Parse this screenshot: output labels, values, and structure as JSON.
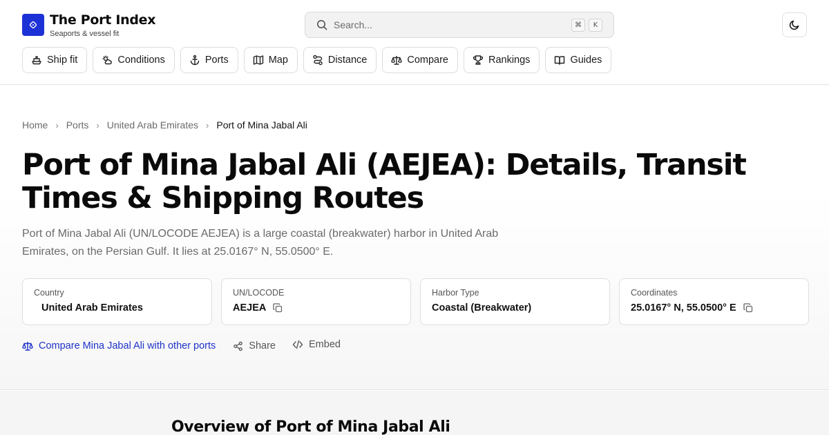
{
  "brand": {
    "title": "The Port Index",
    "subtitle": "Seaports & vessel fit",
    "accent_color": "#1d32d6",
    "logo_icon": "compass-diamond-icon"
  },
  "search": {
    "placeholder": "Search...",
    "shortcut_keys": [
      "⌘",
      "K"
    ]
  },
  "theme_toggle": {
    "icon": "moon-icon"
  },
  "nav": [
    {
      "label": "Ship fit",
      "icon": "ship-icon"
    },
    {
      "label": "Conditions",
      "icon": "weather-icon"
    },
    {
      "label": "Ports",
      "icon": "anchor-icon"
    },
    {
      "label": "Map",
      "icon": "map-icon"
    },
    {
      "label": "Distance",
      "icon": "route-icon"
    },
    {
      "label": "Compare",
      "icon": "scale-icon"
    },
    {
      "label": "Rankings",
      "icon": "trophy-icon"
    },
    {
      "label": "Guides",
      "icon": "book-icon"
    }
  ],
  "breadcrumb": [
    "Home",
    "Ports",
    "United Arab Emirates",
    "Port of Mina Jabal Ali"
  ],
  "page": {
    "title": "Port of Mina Jabal Ali (AEJEA): Details, Transit Times & Shipping Routes",
    "lead": "Port of Mina Jabal Ali (UN/LOCODE AEJEA) is a large coastal (breakwater) harbor in United Arab Emirates, on the Persian Gulf. It lies at 25.0167° N, 55.0500° E."
  },
  "facts": [
    {
      "label": "Country",
      "value": "United Arab Emirates",
      "copy": false
    },
    {
      "label": "UN/LOCODE",
      "value": "AEJEA",
      "copy": true
    },
    {
      "label": "Harbor Type",
      "value": "Coastal (Breakwater)",
      "copy": false
    },
    {
      "label": "Coordinates",
      "value": "25.0167° N, 55.0500° E",
      "copy": true
    }
  ],
  "actions": {
    "compare": "Compare Mina Jabal Ali with other ports",
    "share": "Share",
    "embed": "Embed"
  },
  "overview": {
    "heading": "Overview of Port of Mina Jabal Ali"
  }
}
